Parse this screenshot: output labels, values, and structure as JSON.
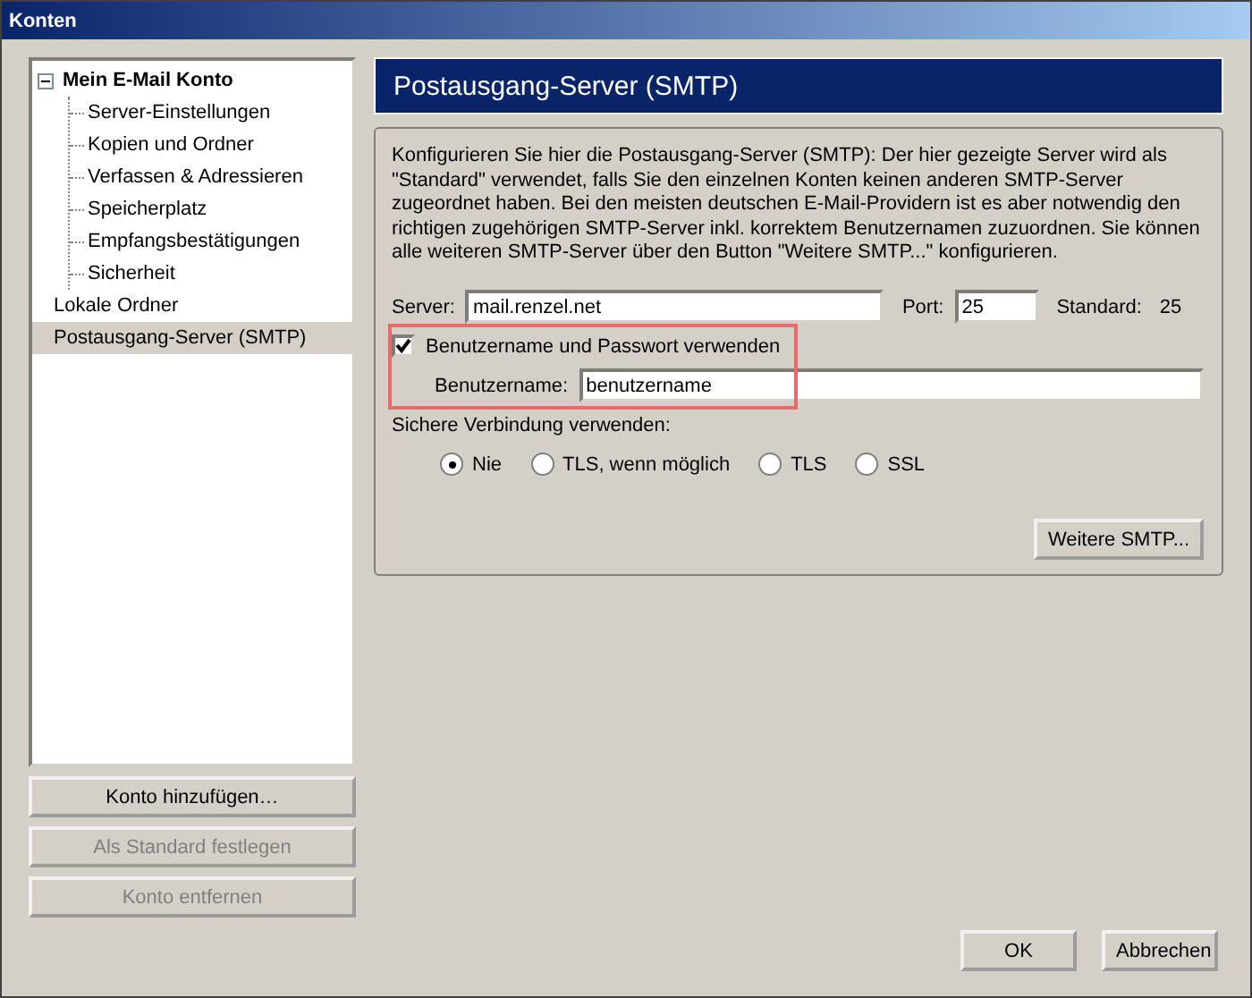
{
  "window": {
    "title": "Konten"
  },
  "tree": [
    {
      "label": "Mein E-Mail Konto",
      "expanded": true,
      "selected": false,
      "children": [
        {
          "label": "Server-Einstellungen",
          "selected": false
        },
        {
          "label": "Kopien und Ordner",
          "selected": false
        },
        {
          "label": "Verfassen & Adressieren",
          "selected": false
        },
        {
          "label": "Speicherplatz",
          "selected": false
        },
        {
          "label": "Empfangsbestätigungen",
          "selected": false
        },
        {
          "label": "Sicherheit",
          "selected": false
        }
      ]
    },
    {
      "label": "Lokale Ordner",
      "selected": false
    },
    {
      "label": "Postausgang-Server (SMTP)",
      "selected": true
    }
  ],
  "account_buttons": [
    {
      "label": "Konto hinzufügen…",
      "disabled": false
    },
    {
      "label": "Als Standard festlegen",
      "disabled": true
    },
    {
      "label": "Konto entfernen",
      "disabled": true
    }
  ],
  "panel": {
    "title": "Postausgang-Server (SMTP)",
    "description": "Konfigurieren Sie hier die Postausgang-Server (SMTP): Der hier gezeigte Server wird als \"Standard\" verwendet, falls Sie den einzelnen Konten keinen anderen SMTP-Server zugeordnet haben. Bei den meisten deutschen E-Mail-Providern ist es aber notwendig den richtigen zugehörigen SMTP-Server inkl. korrektem Benutzernamen zuzuordnen. Sie können alle weiteren SMTP-Server über den Button \"Weitere SMTP...\" konfigurieren.",
    "server_label": "Server:",
    "server": "mail.renzel.net",
    "port_label": "Port:",
    "port": "25",
    "default_label": "Standard:",
    "default_port": "25",
    "auth": {
      "label": "Benutzername und Passwort verwenden",
      "checked": true,
      "highlighted": true,
      "username_label": "Benutzername:",
      "username": "benutzername"
    },
    "secure_label": "Sichere Verbindung verwenden:",
    "secure_options": [
      {
        "label": "Nie",
        "selected": true
      },
      {
        "label": "TLS, wenn möglich",
        "selected": false
      },
      {
        "label": "TLS",
        "selected": false
      },
      {
        "label": "SSL",
        "selected": false
      }
    ],
    "more_button": "Weitere SMTP..."
  },
  "buttons": [
    "OK",
    "Abbrechen"
  ]
}
